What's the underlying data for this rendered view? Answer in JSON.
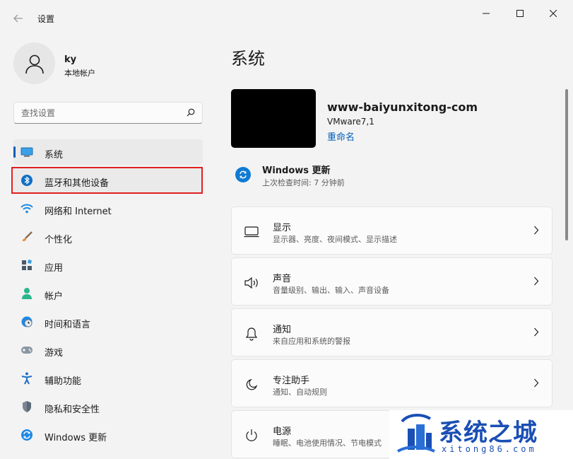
{
  "titlebar": {
    "app_title": "设置"
  },
  "user": {
    "name": "ky",
    "account_type": "本地帐户"
  },
  "search": {
    "placeholder": "查找设置"
  },
  "sidebar": {
    "items": [
      {
        "label": "系统",
        "icon": "display-icon"
      },
      {
        "label": "蓝牙和其他设备",
        "icon": "bluetooth-icon"
      },
      {
        "label": "网络和 Internet",
        "icon": "wifi-icon"
      },
      {
        "label": "个性化",
        "icon": "brush-icon"
      },
      {
        "label": "应用",
        "icon": "apps-icon"
      },
      {
        "label": "帐户",
        "icon": "account-icon"
      },
      {
        "label": "时间和语言",
        "icon": "clock-globe-icon"
      },
      {
        "label": "游戏",
        "icon": "gamepad-icon"
      },
      {
        "label": "辅助功能",
        "icon": "accessibility-icon"
      },
      {
        "label": "隐私和安全性",
        "icon": "shield-icon"
      },
      {
        "label": "Windows 更新",
        "icon": "update-icon"
      }
    ]
  },
  "main": {
    "title": "系统",
    "device": {
      "name": "www-baiyunxitong-com",
      "model": "VMware7,1",
      "rename": "重命名"
    },
    "update": {
      "title": "Windows 更新",
      "subtitle": "上次检查时间: 7 分钟前"
    },
    "cards": [
      {
        "title": "显示",
        "subtitle": "显示器、亮度、夜间模式、显示描述",
        "icon": "monitor-icon"
      },
      {
        "title": "声音",
        "subtitle": "音量级别、输出、输入、声音设备",
        "icon": "speaker-icon"
      },
      {
        "title": "通知",
        "subtitle": "来自应用和系统的警报",
        "icon": "bell-icon"
      },
      {
        "title": "专注助手",
        "subtitle": "通知、自动规则",
        "icon": "moon-icon"
      },
      {
        "title": "电源",
        "subtitle": "睡眠、电池使用情况、节电模式",
        "icon": "power-icon"
      }
    ]
  },
  "watermark": {
    "text": "系统之城",
    "url": "xitong86.com"
  },
  "colors": {
    "accent": "#005fb8",
    "highlight_border": "#e02020",
    "watermark": "#1a4fb5"
  }
}
